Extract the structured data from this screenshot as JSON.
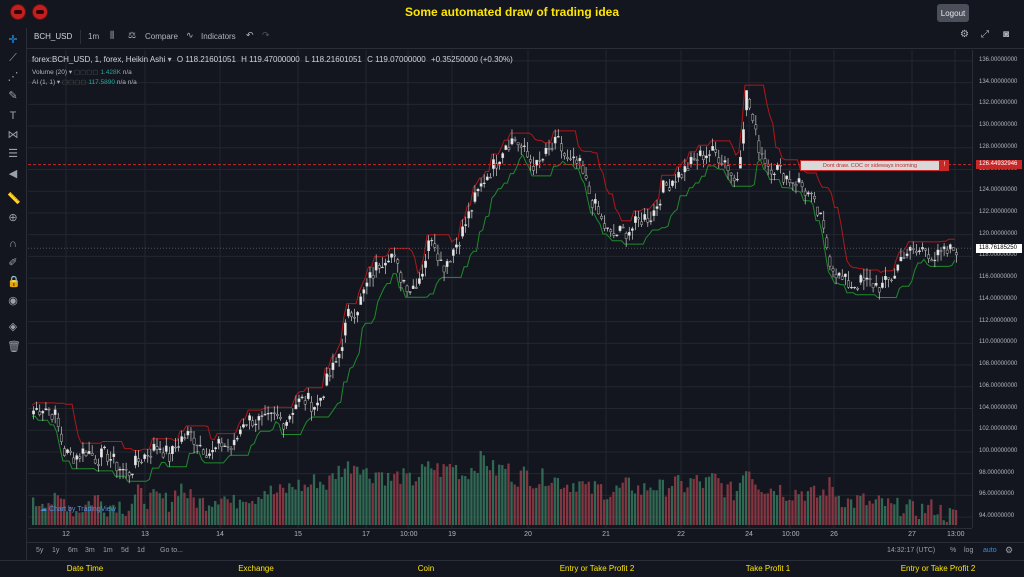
{
  "app": {
    "title": "Some automated draw of trading idea",
    "logout_label": "Logout"
  },
  "toolbar": {
    "symbol": "BCH_USD",
    "interval": "1m",
    "compare_label": "Compare",
    "indicators_label": "Indicators"
  },
  "legend": {
    "title": "forex:BCH_USD, 1, forex, Heikin Ashi",
    "open": "O 118.21601051",
    "high": "H 119.47000000",
    "low": "L 118.21601051",
    "close": "C 119.07000000",
    "change": "+0.35250000 (+0.30%)",
    "volume_label": "Volume (20)",
    "volume_value": "1.428K",
    "volume_na": "n/a",
    "ai_label": "AI (1, 1)",
    "ai_value": "117.5890",
    "ai_na1": "n/a",
    "ai_na2": "n/a"
  },
  "alert": {
    "text": "Dont draw. COC or sideways incoming",
    "flag": "!"
  },
  "price_axis": {
    "ticks": [
      "136.00000000",
      "134.00000000",
      "132.00000000",
      "130.00000000",
      "128.00000000",
      "126.00000000",
      "124.00000000",
      "122.00000000",
      "120.00000000",
      "118.00000000",
      "116.00000000",
      "114.00000000",
      "112.00000000",
      "110.00000000",
      "108.00000000",
      "106.00000000",
      "104.00000000",
      "102.00000000",
      "100.00000000",
      "98.00000000",
      "96.00000000",
      "94.00000000"
    ],
    "alert_price": "126.44932946",
    "current_price": "118.76185250"
  },
  "time_axis": {
    "ticks": [
      "12",
      "13",
      "14",
      "15",
      "17",
      "10:00",
      "19",
      "20",
      "21",
      "22",
      "24",
      "10:00",
      "26",
      "27",
      "13:00"
    ]
  },
  "bottombar": {
    "ranges": [
      "5y",
      "1y",
      "6m",
      "3m",
      "1m",
      "5d",
      "1d"
    ],
    "goto": "Go to...",
    "clock": "14:32:17 (UTC)",
    "pct": "%",
    "log": "log",
    "auto": "auto"
  },
  "watermark": "Chart by TradingView",
  "footer": {
    "items": [
      "Date Time",
      "Exchange",
      "Coin",
      "Entry or Take Profit 2",
      "Take Profit 1",
      "Entry or Take Profit 2"
    ]
  },
  "colors": {
    "up": "#e8e8e8",
    "down": "#1a1a1a",
    "vol_up": "#3b8466",
    "vol_down": "#a8424e",
    "support": "#1e8c2a",
    "resistance": "#b01818",
    "accent_yellow": "#ffe600"
  },
  "chart_data": {
    "type": "candlestick",
    "title": "forex:BCH_USD, 1, forex, Heikin Ashi",
    "ylim": [
      93,
      137
    ],
    "x_labels": [
      "12",
      "13",
      "14",
      "15",
      "17",
      "10:00",
      "19",
      "20",
      "21",
      "22",
      "24",
      "10:00",
      "26",
      "27",
      "13:00"
    ],
    "close_path": [
      103.8,
      104.2,
      103.5,
      99.8,
      99.6,
      100.2,
      99.4,
      99.8,
      98.7,
      98.0,
      99.2,
      100.0,
      100.6,
      99.5,
      101.2,
      101.6,
      100.6,
      99.8,
      100.8,
      100.2,
      102.9,
      103.0,
      102.7,
      103.2,
      102.8,
      104.5,
      104.8,
      104.2,
      106.5,
      108.5,
      112.5,
      113.5,
      115.8,
      117.5,
      118.5,
      116.2,
      115.0,
      116.5,
      120.2,
      117.0,
      118.6,
      120.5,
      123.0,
      125.2,
      126.5,
      128.5,
      128.8,
      127.2,
      126.2,
      127.5,
      128.5,
      126.5,
      126.5,
      123.8,
      121.5,
      119.8,
      120.2,
      120.5,
      121.5,
      121.8,
      124.2,
      125.2,
      125.8,
      126.8,
      127.5,
      127.5,
      126.8,
      124.5,
      133.0,
      128.5,
      126.5,
      126.0,
      125.2,
      124.8,
      123.5,
      121.5,
      117.5,
      115.8,
      115.4,
      115.6,
      115.5,
      115.2,
      116.2,
      118.5,
      118.2,
      118.8,
      117.8,
      118.3,
      118.8
    ],
    "volume_path": [
      2.2,
      3.0,
      2.5,
      2.8,
      1.5,
      2.2,
      3.2,
      2.0,
      2.5,
      1.8,
      3.5,
      2.8,
      3.0,
      2.5,
      4.5,
      3.0,
      2.5,
      2.8,
      3.5,
      2.2,
      3.5,
      3.0,
      4.0,
      3.5,
      3.8,
      4.5,
      4.2,
      5.0,
      4.5,
      6.0,
      6.5,
      7.0,
      5.5,
      6.0,
      5.0,
      5.5,
      4.8,
      5.8,
      6.5,
      6.0,
      6.8,
      5.5,
      6.5,
      7.5,
      6.0,
      6.5,
      5.2,
      5.8,
      4.8,
      5.5,
      5.0,
      4.5,
      4.8,
      3.8,
      4.2,
      3.5,
      4.0,
      4.5,
      3.8,
      4.5,
      4.0,
      4.8,
      4.2,
      5.0,
      4.5,
      5.2,
      4.0,
      3.5,
      6.8,
      4.8,
      4.0,
      4.2,
      3.5,
      3.8,
      3.5,
      3.2,
      4.5,
      3.0,
      2.5,
      2.8,
      2.2,
      2.5,
      1.8,
      2.2,
      1.5,
      1.8,
      2.0,
      1.2,
      1.0
    ],
    "volume_unit": "K",
    "alert_level": 126.44932946,
    "last_price": 118.7618525
  }
}
